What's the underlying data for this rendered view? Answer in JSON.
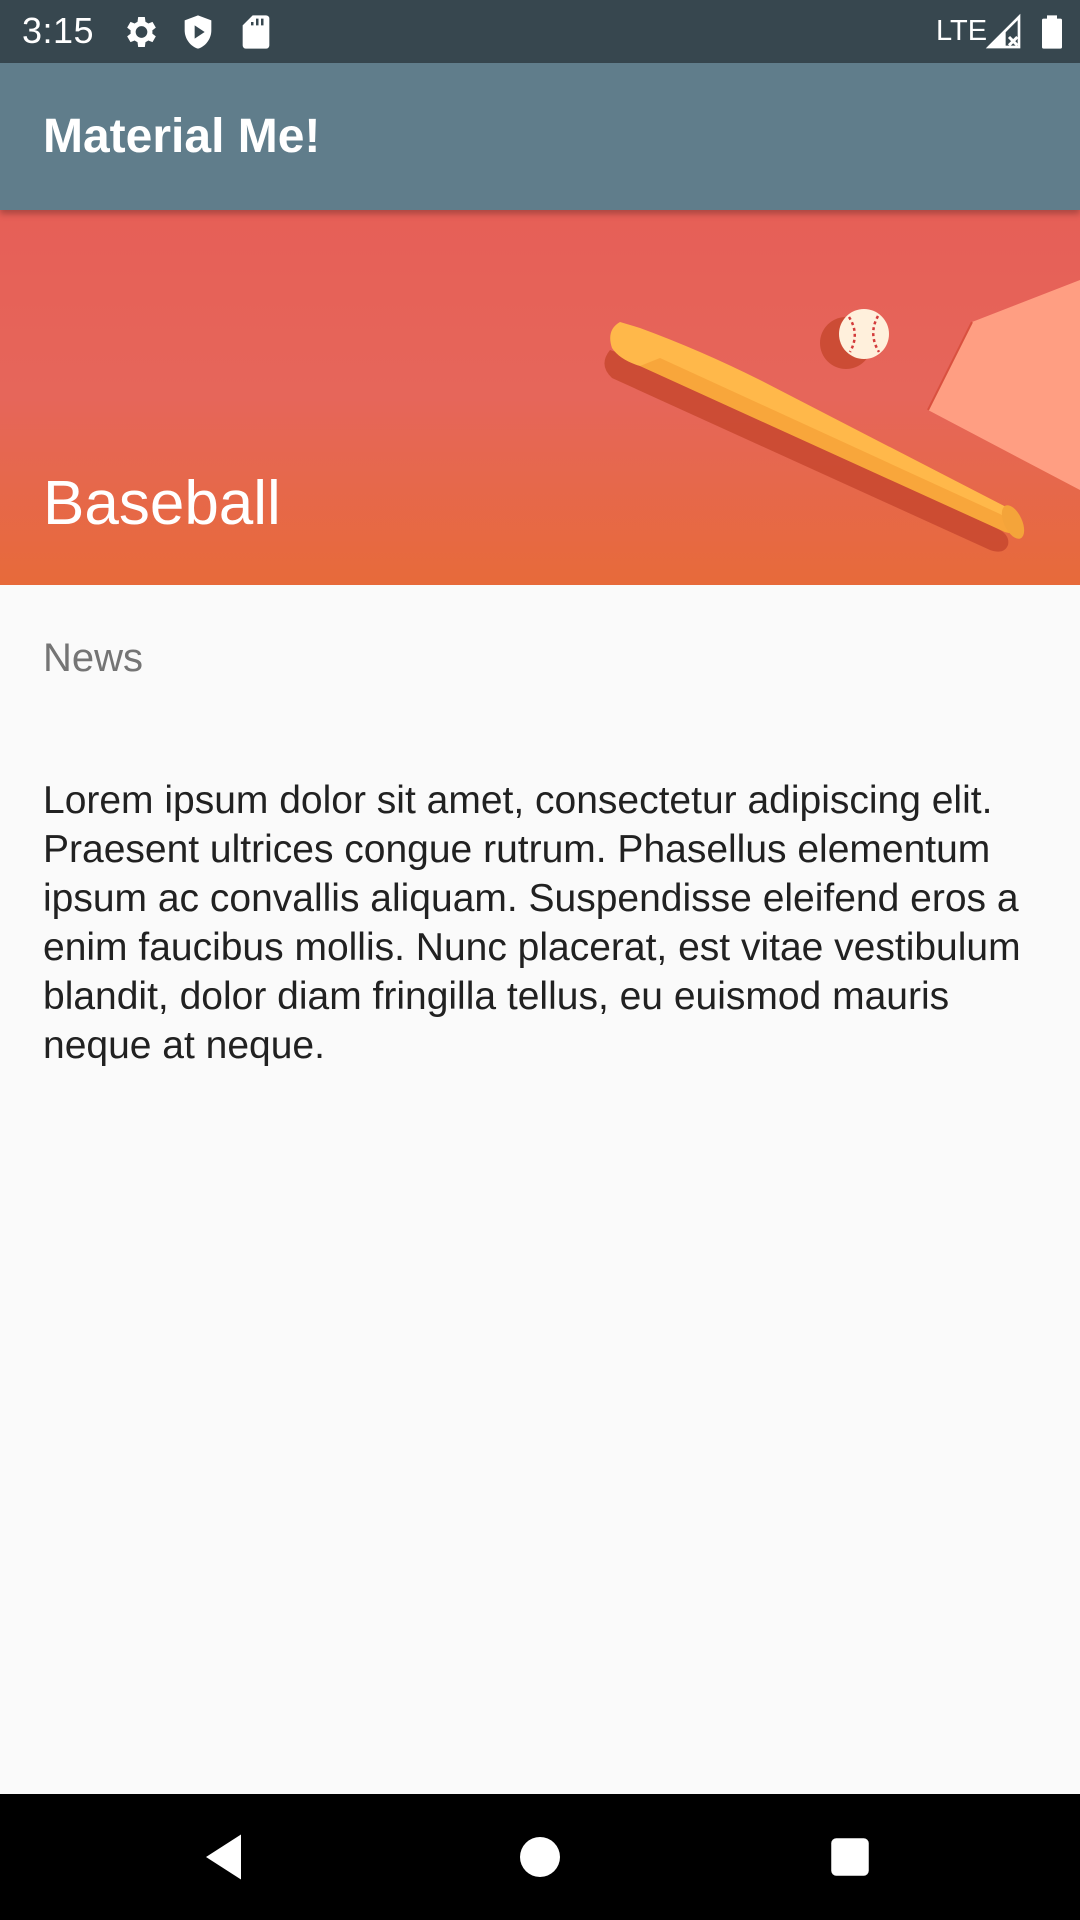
{
  "status_bar": {
    "time": "3:15",
    "network": "LTE",
    "icons": [
      "settings-icon",
      "shield-icon",
      "sd-card-icon",
      "signal-icon",
      "battery-icon"
    ],
    "background": "#37474f"
  },
  "app_bar": {
    "title": "Material Me!",
    "background": "#607d8b"
  },
  "detail": {
    "title": "Baseball",
    "subtitle": "News",
    "body": "Lorem ipsum dolor sit amet, consectetur adipiscing elit. Praesent ultrices congue rutrum. Phasellus elementum ipsum ac convallis aliquam. Suspendisse eleifend eros a enim faucibus mollis. Nunc placerat, est vitae vestibulum blandit, dolor diam fringilla tellus, eu euismod mauris neque at neque.",
    "header_image": "baseball-bat-and-ball-illustration",
    "header_color": "#e6604a"
  },
  "nav_bar": {
    "buttons": [
      "back-icon",
      "home-icon",
      "recents-icon"
    ]
  }
}
